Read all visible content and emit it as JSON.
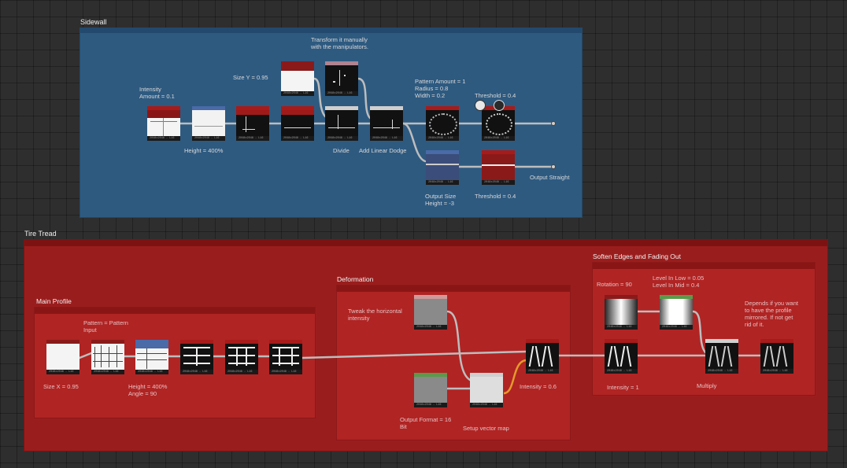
{
  "frames": {
    "sidewall": {
      "title": "Sidewall"
    },
    "tire_tread": {
      "title": "Tire Tread"
    },
    "main_profile": {
      "title": "Main Profile"
    },
    "deformation": {
      "title": "Deformation"
    },
    "soften": {
      "title": "Soften Edges and Fading Out"
    }
  },
  "node_resolution": "2048x2048 - L16",
  "comments": {
    "transform": "Transform it manually\nwith the manipulators.",
    "intensity_amount": "Intensity\nAmount = 0.1",
    "size_y": "Size Y = 0.95",
    "pattern_amount": "Pattern Amount = 1\nRadius = 0.8\nWidth = 0.2",
    "threshold_top": "Threshold = 0.4",
    "height_400": "Height = 400%",
    "divide": "Divide",
    "add_linear_dodge": "Add Linear Dodge",
    "output_size": "Output Size\nHeight = -3",
    "threshold_bottom": "Threshold = 0.4",
    "output_straight": "Output Straight",
    "pattern": "Pattern = Pattern\nInput",
    "size_x": "Size X = 0.95",
    "height_angle": "Height = 400%\nAngle = 90",
    "tweak": "Tweak the horizontal\nintensity",
    "output_format": "Output Format = 16\nBit",
    "setup_vector": "Setup vector map",
    "intensity_06": "Intensity = 0.6",
    "rotation": "Rotation = 90",
    "levels": "Level In Low = 0.05\nLevel In Mid = 0.4",
    "depends": "Depends if you want\nto have the profile\nmirrored. If not get\nrid of it.",
    "intensity_1": "Intensity = 1",
    "multiply": "Multiply"
  },
  "colors": {
    "red_head": "#a81b1b",
    "blue_head": "#4a6aa8",
    "gray_head": "#cfcfcf",
    "pink_head": "#b0838f",
    "green_head": "#5a9a4a",
    "darkred_head": "#8a1a1a"
  }
}
